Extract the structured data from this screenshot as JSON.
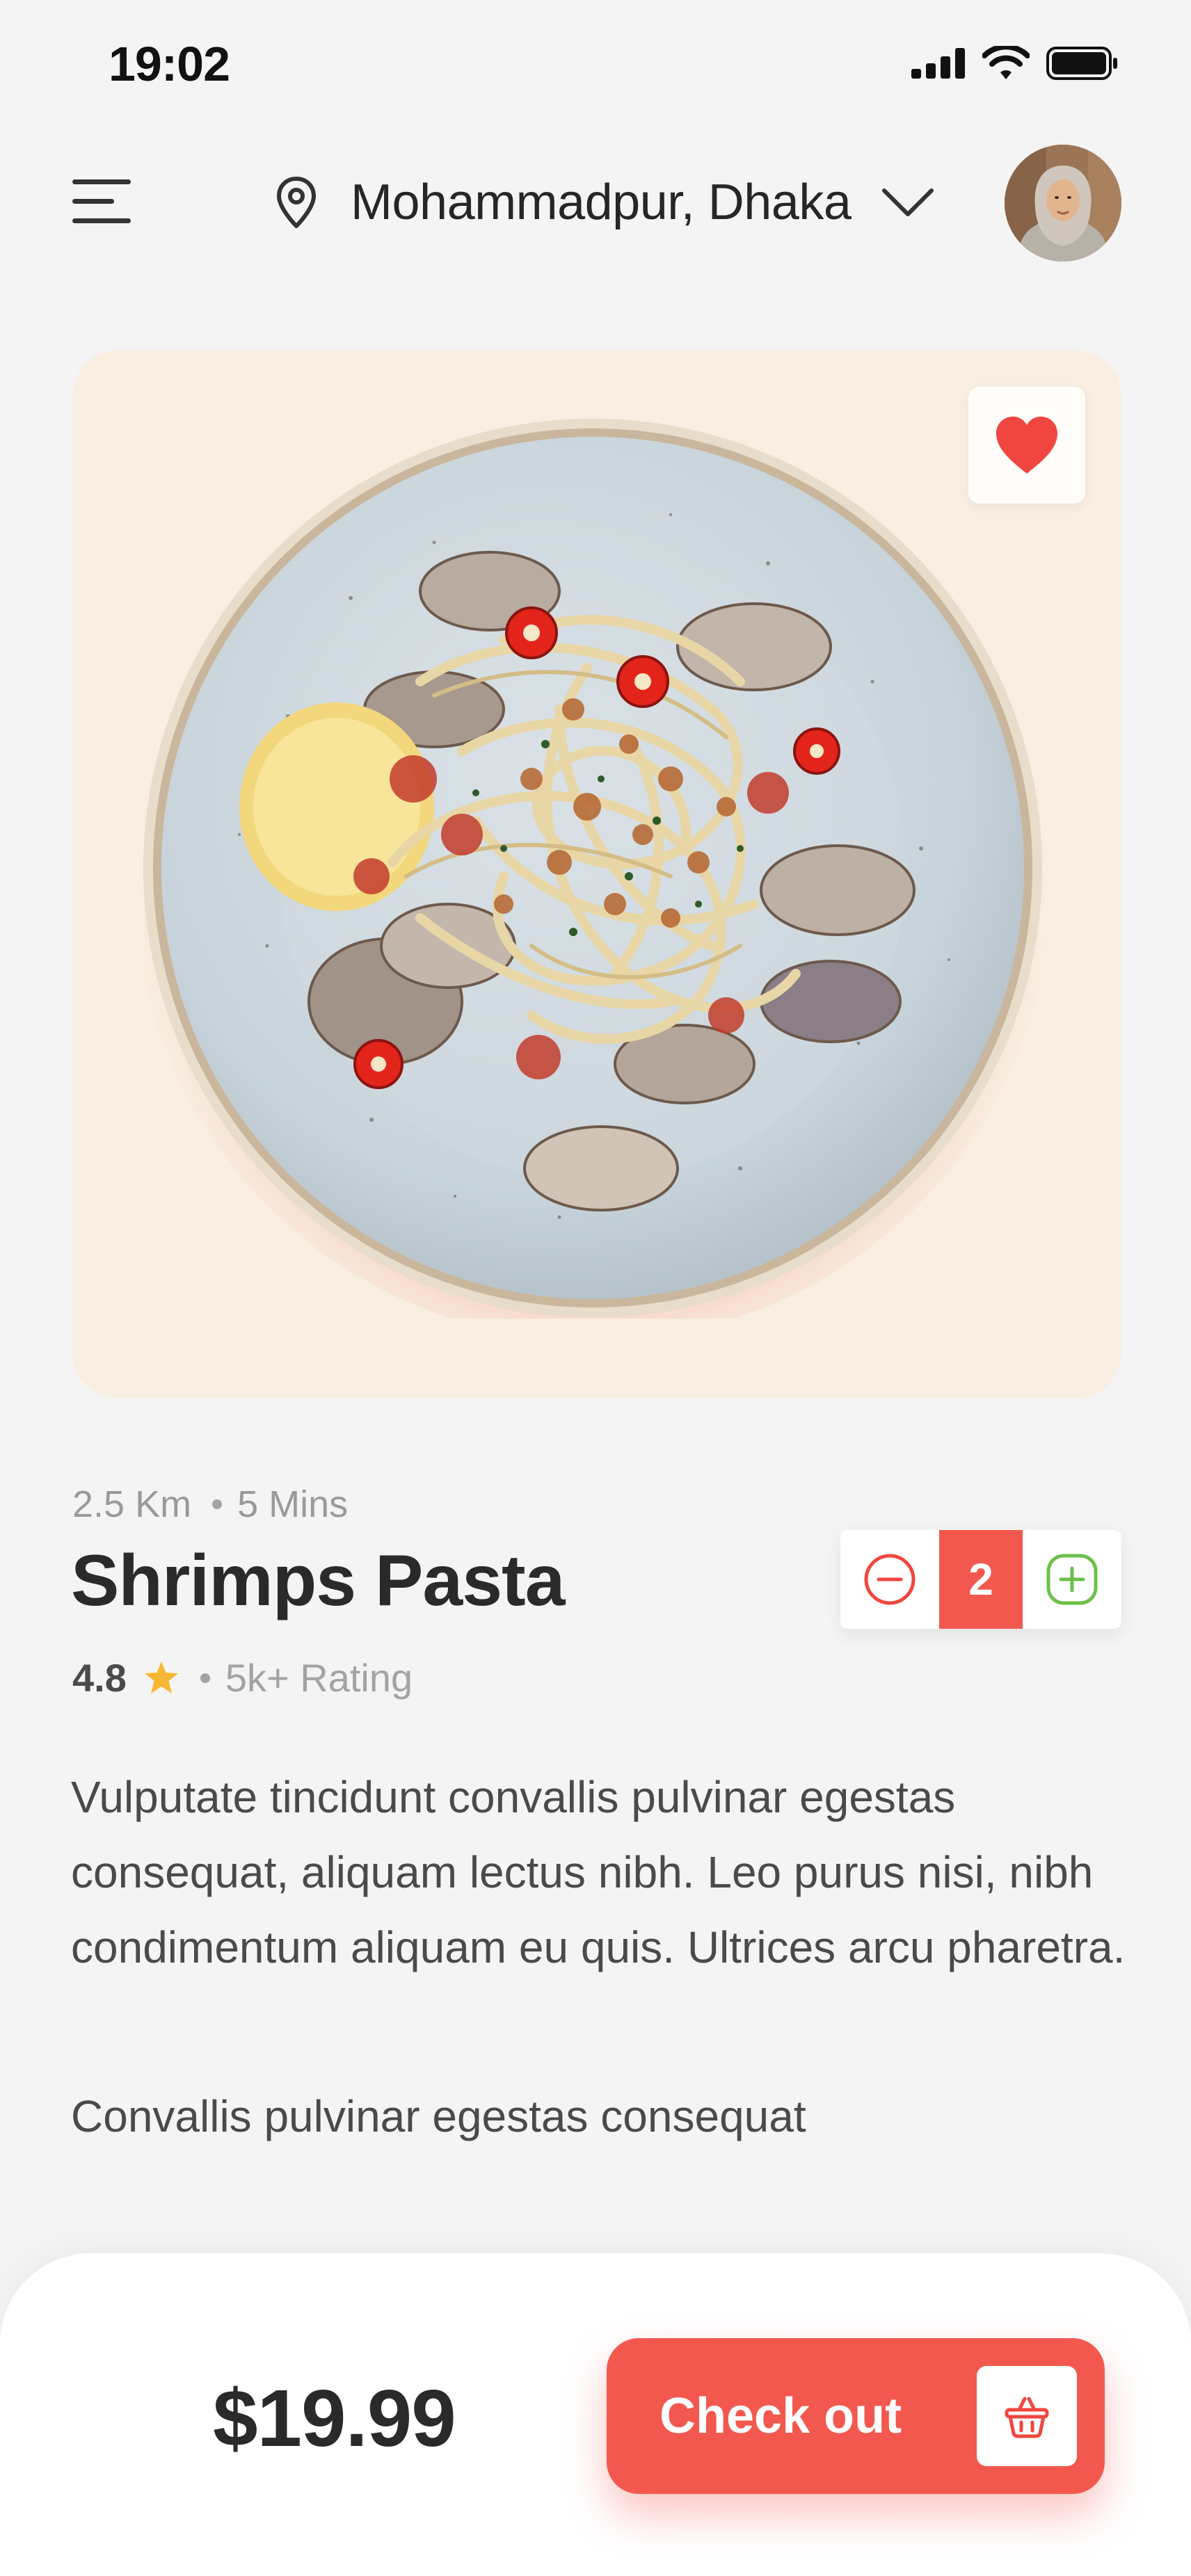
{
  "status_bar": {
    "time": "19:02"
  },
  "header": {
    "location": "Mohammadpur, Dhaka"
  },
  "item": {
    "distance": "2.5 Km",
    "time": "5 Mins",
    "name": "Shrimps Pasta",
    "rating": "4.8",
    "rating_count": "5k+ Rating",
    "quantity": "2",
    "description": "Vulputate tincidunt convallis pulvinar egestas consequat, aliquam lectus nibh. Leo purus nisi, nibh condimentum aliquam eu quis. Ultrices arcu pharetra.",
    "description_extra": "Convallis pulvinar egestas consequat",
    "favorited": true
  },
  "checkout": {
    "price": "$19.99",
    "button_label": "Check out"
  },
  "icons": [
    "menu-icon",
    "location-pin-icon",
    "chevron-down-icon",
    "heart-icon",
    "star-icon",
    "minus-icon",
    "plus-icon",
    "basket-icon",
    "signal-icon",
    "wifi-icon",
    "battery-icon"
  ],
  "colors": {
    "accent": "#f3584f",
    "plus": "#6cc04a",
    "star": "#f7b733",
    "card_bg": "#f8efe2"
  }
}
